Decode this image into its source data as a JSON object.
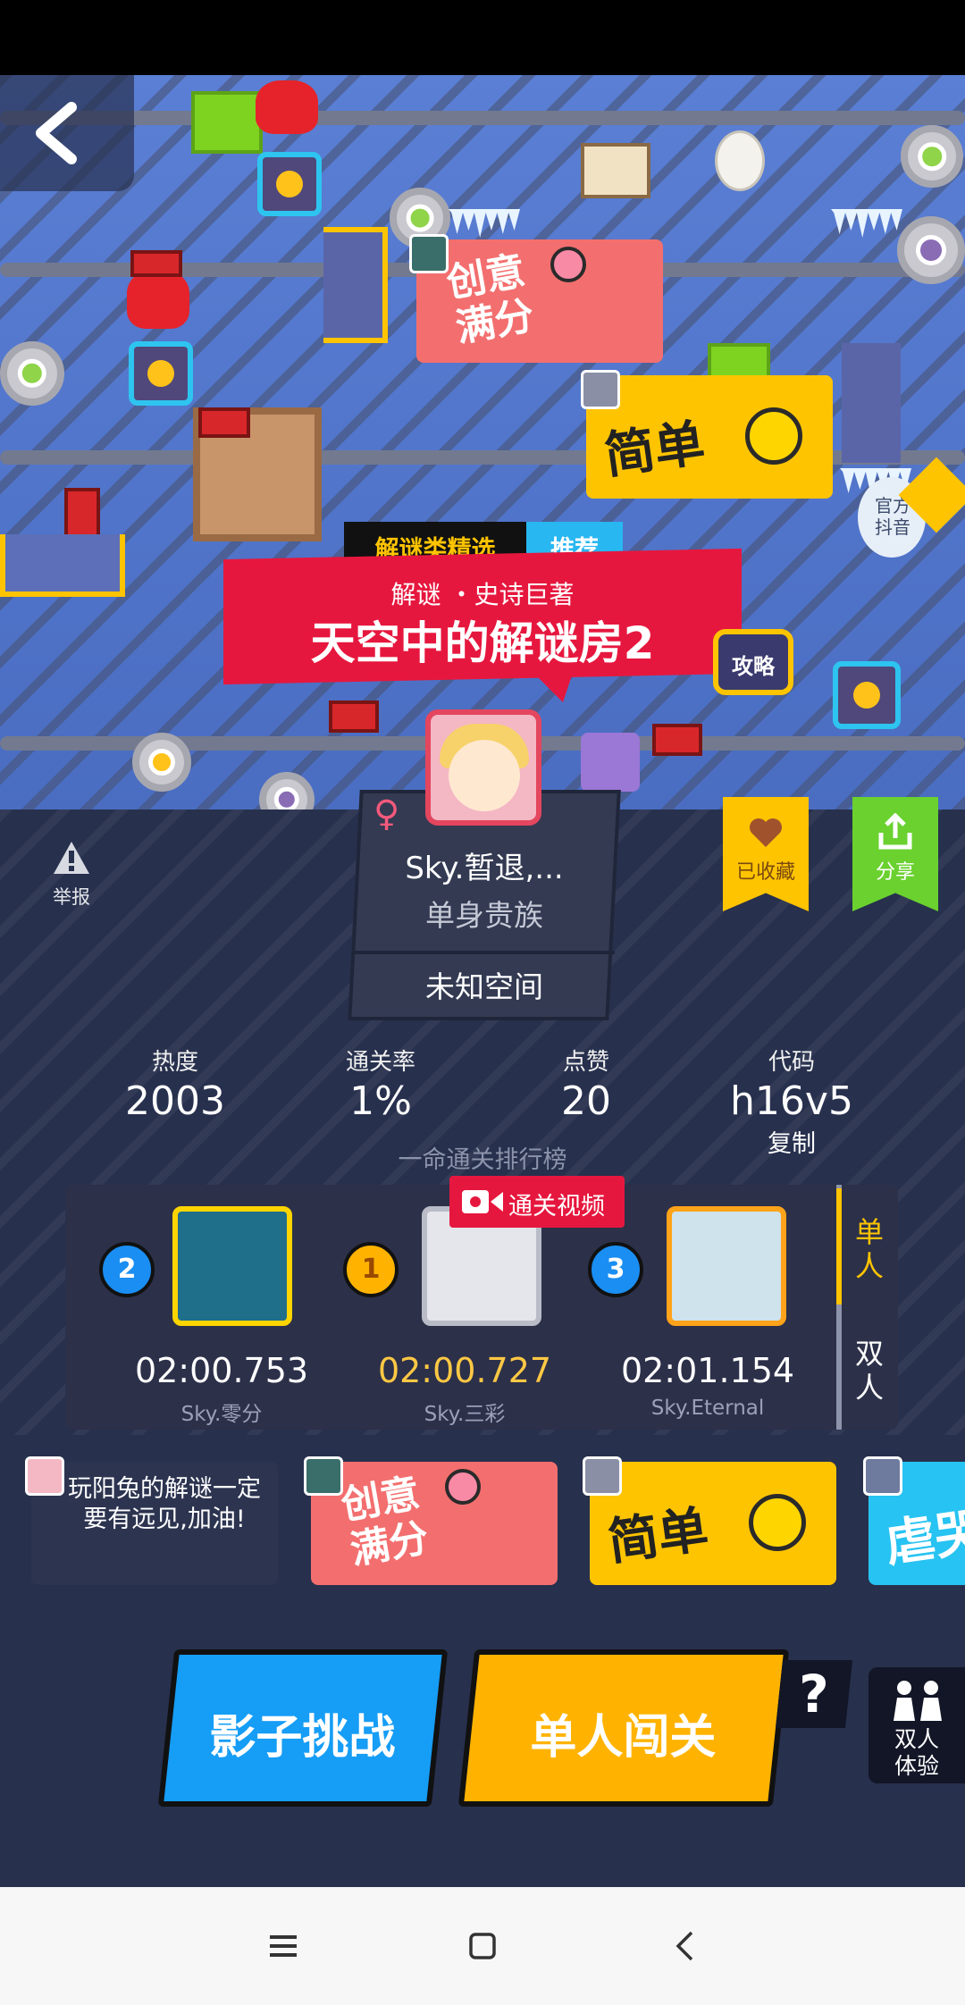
{
  "app": {
    "level_tags": {
      "category": "解谜类精选",
      "badge": "推荐"
    },
    "level_subtitle": "解谜 ・史诗巨著",
    "level_title": "天空中的解谜房2",
    "strategy_button": "攻略",
    "official_label": "官方\n抖音"
  },
  "style_cards": [
    {
      "label_top": "创意",
      "label_bottom": "满分",
      "color": "#f36f6f"
    },
    {
      "label": "简单",
      "color": "#ffc400"
    },
    {
      "label": "虐哭",
      "color": "#27c3f2"
    }
  ],
  "author": {
    "name": "Sky.暂退,...",
    "title": "单身贵族",
    "space_label": "未知空间",
    "gender_icon": "female-icon"
  },
  "actions": {
    "report": "举报",
    "favorite": "已收藏",
    "share": "分享"
  },
  "stats": [
    {
      "label": "热度",
      "value": "2003"
    },
    {
      "label": "通关率",
      "value": "1%"
    },
    {
      "label": "点赞",
      "value": "20"
    },
    {
      "label": "代码",
      "value": "h16v5"
    }
  ],
  "copy_label": "复制",
  "leaderboard": {
    "header": "一命通关排行榜",
    "video_badge": "通关视频",
    "modes": [
      "单人",
      "双人"
    ],
    "active_mode": "单人",
    "players": [
      {
        "rank": "2",
        "time": "02:00.753",
        "name": "Sky.零分"
      },
      {
        "rank": "1",
        "time": "02:00.727",
        "name": "Sky.三彩"
      },
      {
        "rank": "3",
        "time": "02:01.154",
        "name": "Sky.Eternal"
      }
    ]
  },
  "comment": "玩阳兔的解谜一定要有远见,加油!",
  "buttons": {
    "shadow_challenge": "影子挑战",
    "solo_play": "单人闯关",
    "help": "?",
    "duo_trial": "双人\n体验"
  },
  "colors": {
    "accent_red": "#e6173e",
    "accent_yellow": "#ffc400",
    "accent_blue": "#169df5",
    "time_highlight": "#ffc844"
  }
}
